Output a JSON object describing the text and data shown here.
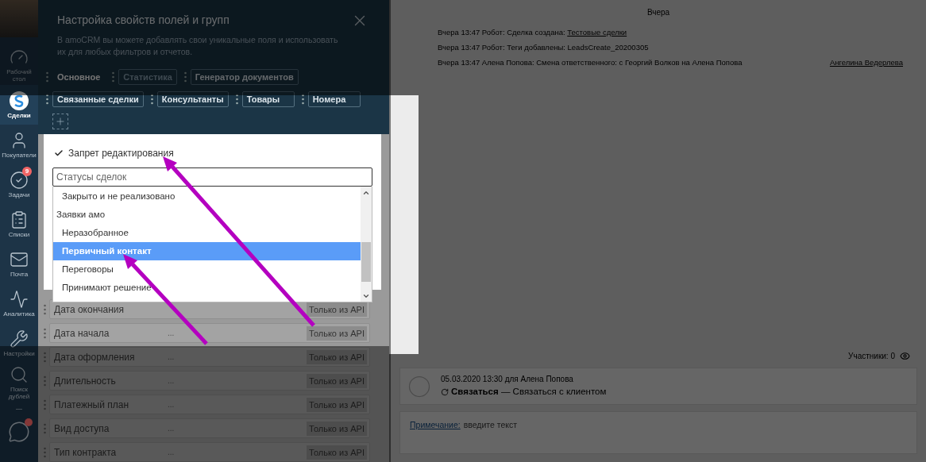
{
  "sidebar": {
    "items": [
      {
        "label": "Рабочий стол",
        "selected": false
      },
      {
        "label": "Сделки",
        "selected": true
      },
      {
        "label": "Покупатели",
        "selected": false
      },
      {
        "label": "Задачи",
        "selected": false,
        "badge": "9"
      },
      {
        "label": "Списки",
        "selected": false
      },
      {
        "label": "Почта",
        "selected": false
      },
      {
        "label": "Аналитика",
        "selected": false
      },
      {
        "label": "Настройки",
        "selected": false
      },
      {
        "label": "Поиск дублей",
        "selected": false
      }
    ]
  },
  "modal": {
    "title": "Настройка свойств полей и групп",
    "description": "В amoCRM вы можете добавлять свои уникальные поля и использовать их для любых фильтров и отчетов.",
    "tab_rows": [
      [
        {
          "label": "Основное",
          "selected": true,
          "disabled": false
        },
        {
          "label": "Статистика",
          "selected": false,
          "disabled": true
        },
        {
          "label": "Генератор документов",
          "selected": false,
          "disabled": false
        }
      ],
      [
        {
          "label": "Связанные сделки",
          "selected": false,
          "disabled": false
        },
        {
          "label": "Консультанты",
          "selected": false,
          "disabled": false
        },
        {
          "label": "Товары",
          "selected": false,
          "disabled": false
        },
        {
          "label": "Номера",
          "selected": false,
          "disabled": false
        }
      ]
    ]
  },
  "popup": {
    "checkbox": {
      "label": "Запрет редактирования",
      "checked": true
    },
    "select": {
      "placeholder": "Статусы сделок"
    },
    "options": [
      {
        "kind": "status",
        "label": "Закрыто и не реализовано",
        "selected": false
      },
      {
        "kind": "group",
        "label": "Заявки амо",
        "selected": false
      },
      {
        "kind": "status",
        "label": "Неразобранное",
        "selected": false
      },
      {
        "kind": "status",
        "label": "Первичный контакт",
        "selected": true
      },
      {
        "kind": "status",
        "label": "Переговоры",
        "selected": false
      },
      {
        "kind": "status",
        "label": "Принимают решение",
        "selected": false
      }
    ]
  },
  "fields": [
    {
      "label": "Дата окончания",
      "tag": "Только из API"
    },
    {
      "label": "Дата начала",
      "value": "...",
      "tag": "Только из API"
    },
    {
      "label": "Дата оформления",
      "value": "...",
      "tag": "Только из API"
    },
    {
      "label": "Длительность",
      "value": "...",
      "tag": "Только из API"
    },
    {
      "label": "Платежный план",
      "value": "...",
      "tag": "Только из API"
    },
    {
      "label": "Вид доступа",
      "value": "...",
      "tag": "Только из API"
    },
    {
      "label": "Тип контракта",
      "value": "...",
      "tag": "Только из API"
    }
  ],
  "feed": {
    "date_header": "Вчера",
    "entries": [
      {
        "text": "Вчера 13:47 Робот: Сделка создана:",
        "link": "Тестовые сделки"
      },
      {
        "text": "Вчера 13:47 Робот: Теги добавлены: LeadsCreate_20200305"
      },
      {
        "text": "Вчера 13:47 Алена Попова: Смена ответственного: с Георгий Волков на Алена Попова",
        "author": "Ангелина Ведерлева"
      }
    ],
    "participants": "Участники: 0",
    "task": {
      "meta": "05.03.2020 13:30 для Алена Попова",
      "title": "**Связаться** — Связаться с клиентом"
    },
    "note": {
      "link": "Примечание:",
      "placeholder": "введите текст"
    }
  }
}
